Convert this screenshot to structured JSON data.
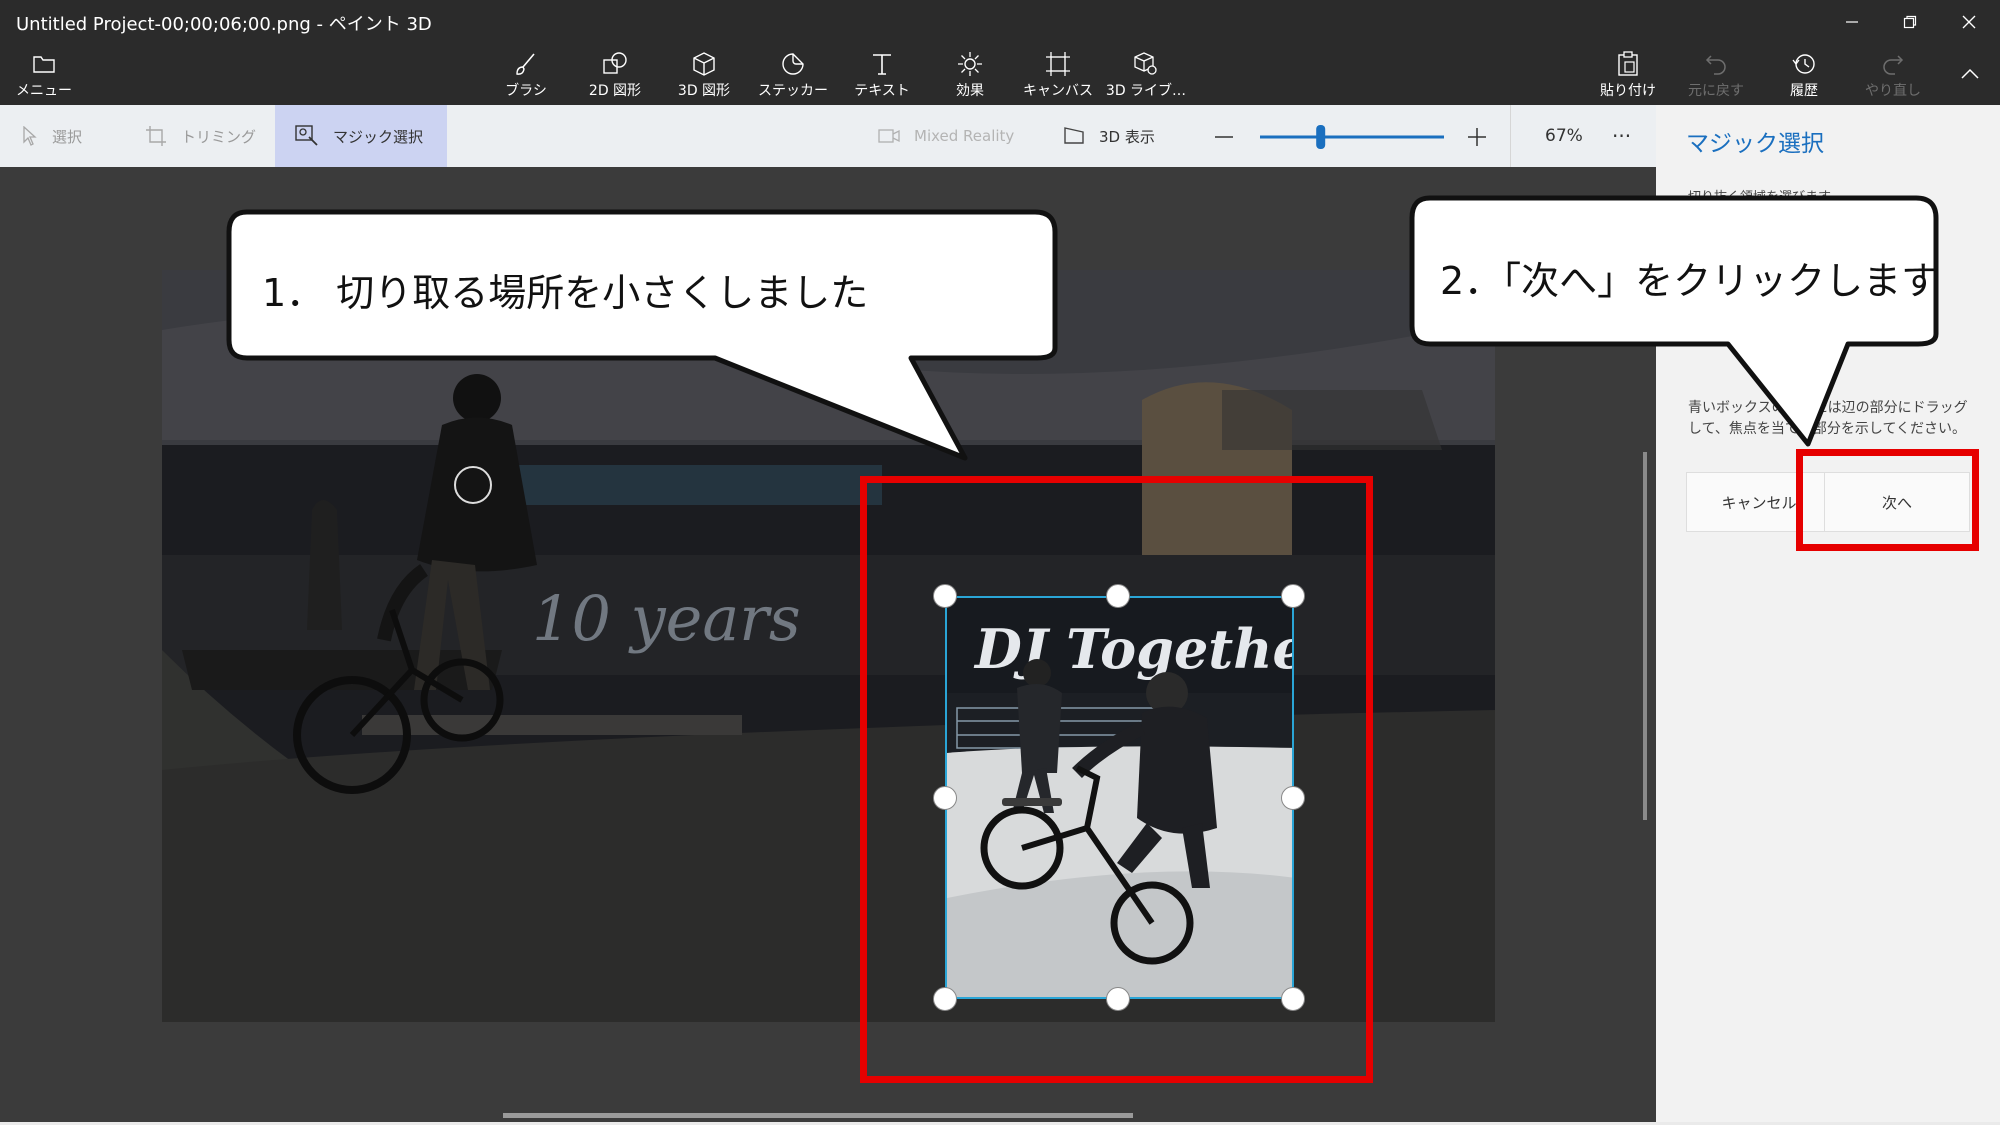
{
  "window": {
    "title": "Untitled Project-00;00;06;00.png - ペイント 3D"
  },
  "ribbon": {
    "menu": "メニュー",
    "tools": [
      {
        "label": "ブラシ",
        "icon": "brush-icon"
      },
      {
        "label": "2D 図形",
        "icon": "2d-shapes-icon"
      },
      {
        "label": "3D 図形",
        "icon": "3d-shapes-icon"
      },
      {
        "label": "ステッカー",
        "icon": "sticker-icon"
      },
      {
        "label": "テキスト",
        "icon": "text-icon"
      },
      {
        "label": "効果",
        "icon": "effects-icon"
      },
      {
        "label": "キャンバス",
        "icon": "canvas-icon"
      },
      {
        "label": "3D ライブ…",
        "icon": "3d-library-icon"
      }
    ],
    "actions": {
      "paste": "貼り付け",
      "undo": "元に戻す",
      "history": "履歴",
      "redo": "やり直し"
    }
  },
  "toolbar": {
    "select": "選択",
    "crop": "トリミング",
    "magic_select": "マジック選択",
    "mixed_reality": "Mixed Reality",
    "view_3d": "3D 表示",
    "zoom_value": 0.33,
    "zoom_percent": "67%",
    "more": "···"
  },
  "panel": {
    "title": "マジック選択",
    "subtitle": "切り抜く領域を選びます",
    "instructions": "青いボックスの角または辺の部分にドラッグして、焦点を当てる部分を示してください。",
    "cancel": "キャンセル",
    "next": "次へ"
  },
  "photo": {
    "graffiti_left": "10 years",
    "graffiti_right": "DJ Together"
  },
  "callouts": {
    "first": "1．  切り取る場所を小さくしました",
    "second": "2．「次へ」をクリックします"
  },
  "colors": {
    "accent": "#1a6fbf",
    "highlight_red": "#e60000",
    "selection_blue": "#2aa5d6",
    "magic_tab": "#ccd3f2"
  }
}
